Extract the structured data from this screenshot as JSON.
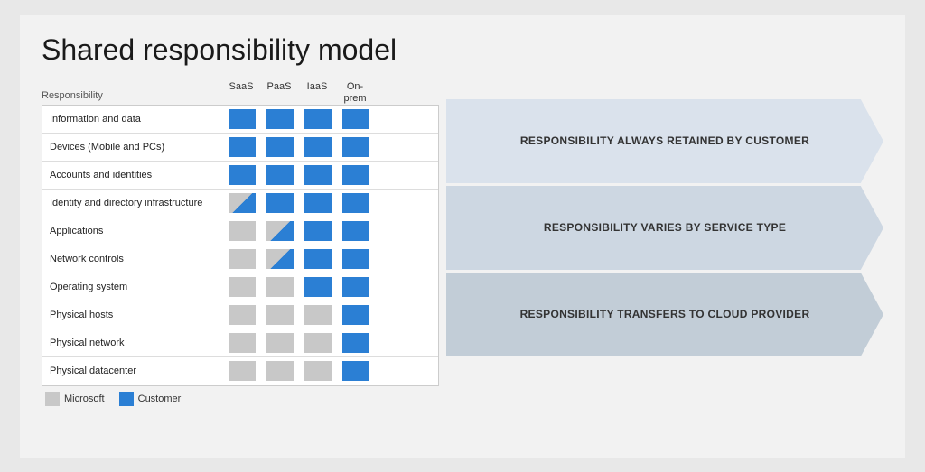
{
  "title": "Shared responsibility model",
  "table": {
    "header": {
      "responsibility_label": "Responsibility",
      "columns": [
        "SaaS",
        "PaaS",
        "IaaS",
        "On-\nprem"
      ]
    },
    "rows": [
      {
        "label": "Information and data",
        "cells": [
          "blue",
          "blue",
          "blue",
          "blue"
        ]
      },
      {
        "label": "Devices (Mobile and PCs)",
        "cells": [
          "blue",
          "blue",
          "blue",
          "blue"
        ]
      },
      {
        "label": "Accounts and identities",
        "cells": [
          "blue",
          "blue",
          "blue",
          "blue"
        ]
      },
      {
        "label": "Identity and directory infrastructure",
        "cells": [
          "half",
          "blue",
          "blue",
          "blue"
        ]
      },
      {
        "label": "Applications",
        "cells": [
          "gray",
          "half",
          "blue",
          "blue"
        ]
      },
      {
        "label": "Network controls",
        "cells": [
          "gray",
          "half",
          "blue",
          "blue"
        ]
      },
      {
        "label": "Operating system",
        "cells": [
          "gray",
          "gray",
          "blue",
          "blue"
        ]
      },
      {
        "label": "Physical hosts",
        "cells": [
          "gray",
          "gray",
          "gray",
          "blue"
        ]
      },
      {
        "label": "Physical network",
        "cells": [
          "gray",
          "gray",
          "gray",
          "blue"
        ]
      },
      {
        "label": "Physical datacenter",
        "cells": [
          "gray",
          "gray",
          "gray",
          "blue"
        ]
      }
    ]
  },
  "legend": {
    "microsoft_label": "Microsoft",
    "microsoft_color": "#c8c8c8",
    "customer_label": "Customer",
    "customer_color": "#2b7fd4"
  },
  "arrows": [
    {
      "text": "RESPONSIBILITY ALWAYS RETAINED BY CUSTOMER",
      "rows": 3
    },
    {
      "text": "RESPONSIBILITY VARIES BY SERVICE TYPE",
      "rows": 3
    },
    {
      "text": "RESPONSIBILITY TRANSFERS TO CLOUD PROVIDER",
      "rows": 3
    }
  ]
}
